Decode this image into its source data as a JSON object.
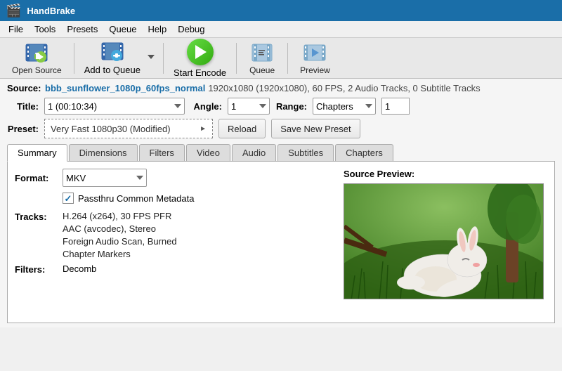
{
  "app": {
    "title": "HandBrake",
    "icon": "🎬"
  },
  "menu": {
    "items": [
      "File",
      "Tools",
      "Presets",
      "Queue",
      "Help",
      "Debug"
    ]
  },
  "toolbar": {
    "open_source_label": "Open Source",
    "add_to_queue_label": "Add to Queue",
    "start_encode_label": "Start Encode",
    "queue_label": "Queue",
    "preview_label": "Preview"
  },
  "source": {
    "label": "Source:",
    "filename": "bbb_sunflower_1080p_60fps_normal",
    "info": "1920x1080 (1920x1080), 60 FPS, 2 Audio Tracks, 0 Subtitle Tracks"
  },
  "title_row": {
    "title_label": "Title:",
    "title_value": "1 (00:10:34)",
    "angle_label": "Angle:",
    "angle_value": "1",
    "range_label": "Range:",
    "range_value": "Chapters",
    "range_num": "1"
  },
  "preset_row": {
    "label": "Preset:",
    "preset_text": "Very Fast 1080p30 (Modified)",
    "reload_label": "Reload",
    "save_new_preset_label": "Save New Preset"
  },
  "tabs": {
    "items": [
      "Summary",
      "Dimensions",
      "Filters",
      "Video",
      "Audio",
      "Subtitles",
      "Chapters"
    ],
    "active": "Summary"
  },
  "summary_tab": {
    "format_label": "Format:",
    "format_value": "MKV",
    "passthru_label": "Passthru Common Metadata",
    "tracks_label": "Tracks:",
    "tracks": [
      "H.264 (x264), 30 FPS PFR",
      "AAC (avcodec), Stereo",
      "Foreign Audio Scan, Burned",
      "Chapter Markers"
    ],
    "filters_label": "Filters:",
    "filters_value": "Decomb",
    "source_preview_label": "Source Preview:"
  },
  "colors": {
    "titlebar_bg": "#1a6ea8",
    "play_green": "#44bb22",
    "link_blue": "#1a6ea8"
  }
}
